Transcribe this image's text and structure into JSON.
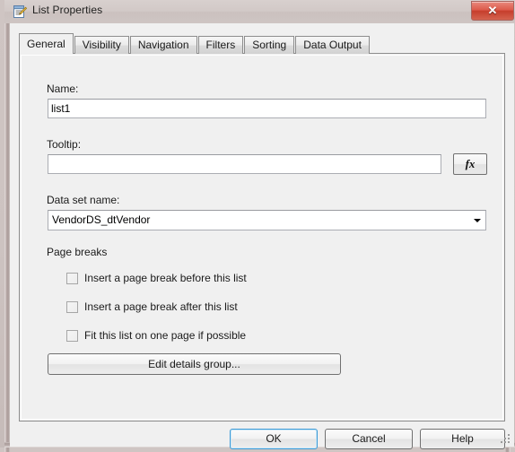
{
  "window": {
    "title": "List Properties",
    "icon": "properties-document-icon",
    "close_label": "✕",
    "frame_color": "#cfc5c3",
    "titlebar_color": "#d2c9c7",
    "close_button_color": "#c63e2c"
  },
  "tabs": [
    {
      "label": "General",
      "active": true
    },
    {
      "label": "Visibility",
      "active": false
    },
    {
      "label": "Navigation",
      "active": false
    },
    {
      "label": "Filters",
      "active": false
    },
    {
      "label": "Sorting",
      "active": false
    },
    {
      "label": "Data Output",
      "active": false
    }
  ],
  "general": {
    "name_label": "Name:",
    "name_value": "list1",
    "name_placeholder": "",
    "tooltip_label": "Tooltip:",
    "tooltip_value": "",
    "tooltip_placeholder": "",
    "fx_label": "fx",
    "dataset_label": "Data set name:",
    "dataset_value": "VendorDS_dtVendor",
    "dataset_options": [
      "VendorDS_dtVendor"
    ],
    "pagebreaks_label": "Page breaks",
    "checkboxes": [
      {
        "label": "Insert a page break before this list",
        "checked": false
      },
      {
        "label": "Insert a page break after this list",
        "checked": false
      },
      {
        "label": "Fit this list on one page if possible",
        "checked": false
      }
    ],
    "edit_details_label": "Edit details group..."
  },
  "footer": {
    "ok_label": "OK",
    "cancel_label": "Cancel",
    "help_label": "Help",
    "default_button": "OK",
    "focus_color": "#3c9ad6"
  }
}
